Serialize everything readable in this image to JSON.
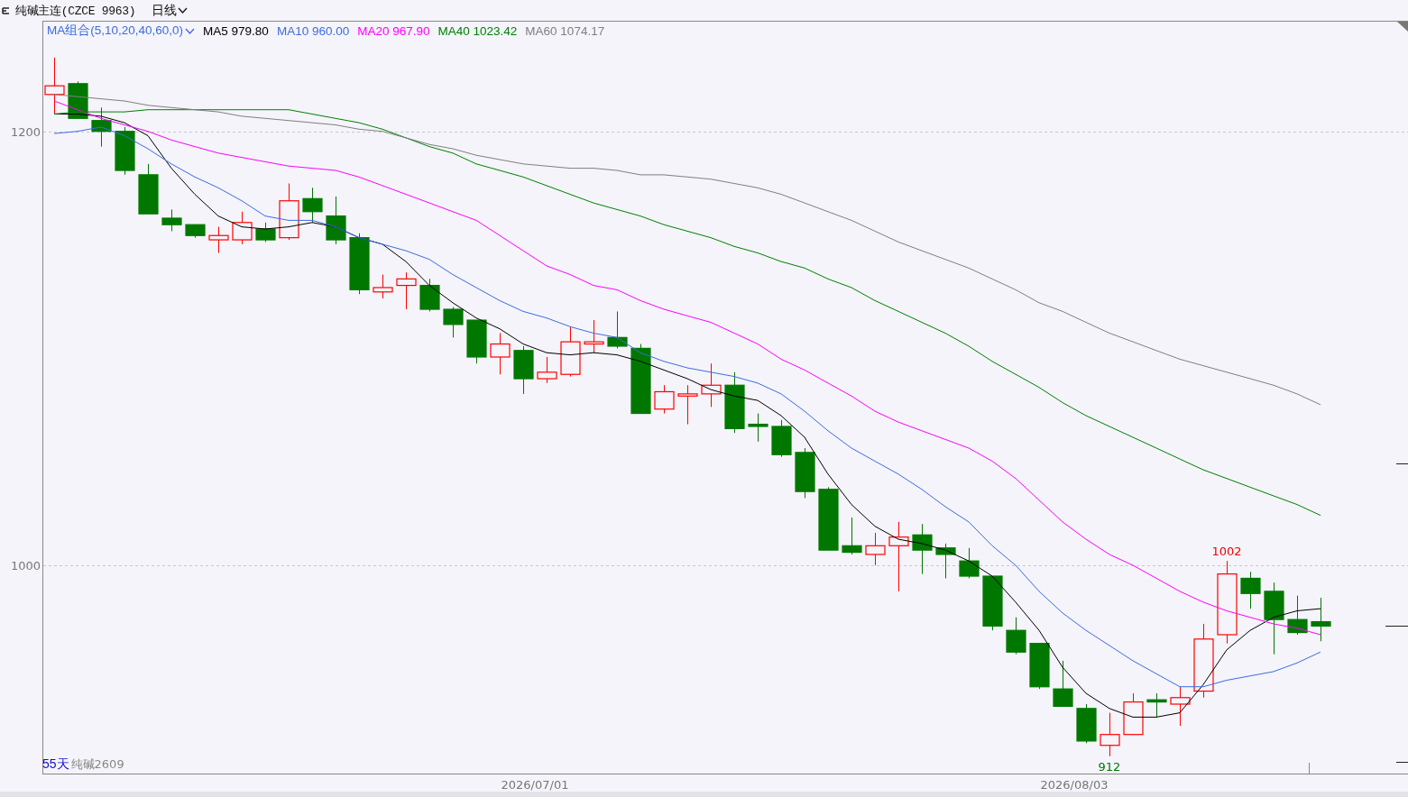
{
  "header": {
    "title": "纯碱主连(CZCE 9963)",
    "period": "日线"
  },
  "legend": {
    "group": "MA组合(5,10,20,40,60,0)",
    "values": [
      "979.80",
      "960.00",
      "967.90",
      "1023.42",
      "1074.17"
    ]
  },
  "chart": {
    "footer_count": "55天",
    "chart_data": {
      "type": "candlestick",
      "ylim": [
        904,
        1251
      ],
      "yticks": [
        1000,
        1200
      ],
      "series": [
        {
          "name": "纯碱2609",
          "ohlc": [
            [
              1217,
              1234,
              1208,
              1221
            ],
            [
              1222,
              1223,
              1206,
              1206
            ],
            [
              1205,
              1211,
              1193,
              1200
            ],
            [
              1200,
              1202,
              1180,
              1182
            ],
            [
              1180,
              1185,
              1162,
              1162
            ],
            [
              1160,
              1164,
              1154,
              1157
            ],
            [
              1157,
              1157,
              1151,
              1152
            ],
            [
              1150,
              1156,
              1144,
              1152
            ],
            [
              1150,
              1163,
              1148,
              1158
            ],
            [
              1155,
              1158,
              1149,
              1150
            ],
            [
              1151,
              1176,
              1150,
              1168
            ],
            [
              1169,
              1174,
              1158,
              1163
            ],
            [
              1161,
              1170,
              1148,
              1150
            ],
            [
              1151,
              1153,
              1125,
              1127
            ],
            [
              1126,
              1134,
              1123,
              1128
            ],
            [
              1129,
              1135,
              1118,
              1132
            ],
            [
              1129,
              1132,
              1117,
              1118
            ],
            [
              1118,
              1119,
              1105,
              1111
            ],
            [
              1113,
              1113,
              1093,
              1096
            ],
            [
              1096,
              1107,
              1088,
              1102
            ],
            [
              1099,
              1101,
              1079,
              1086
            ],
            [
              1086,
              1096,
              1084,
              1089
            ],
            [
              1088,
              1110,
              1087,
              1103
            ],
            [
              1102,
              1113,
              1098,
              1103
            ],
            [
              1105,
              1117,
              1100,
              1101
            ],
            [
              1100,
              1102,
              1070,
              1070
            ],
            [
              1072,
              1083,
              1070,
              1080
            ],
            [
              1078,
              1083,
              1065,
              1079
            ],
            [
              1079,
              1093,
              1073,
              1083
            ],
            [
              1083,
              1089,
              1061,
              1063
            ],
            [
              1065,
              1070,
              1057,
              1064
            ],
            [
              1064,
              1067,
              1050,
              1051
            ],
            [
              1052,
              1054,
              1031,
              1034
            ],
            [
              1035,
              1036,
              1007,
              1007
            ],
            [
              1009,
              1022,
              1005,
              1006
            ],
            [
              1005,
              1015,
              1000,
              1009
            ],
            [
              1009,
              1020,
              988,
              1013
            ],
            [
              1014,
              1019,
              996,
              1007
            ],
            [
              1008,
              1010,
              994,
              1005
            ],
            [
              1002,
              1008,
              994,
              995
            ],
            [
              995,
              995,
              970,
              972
            ],
            [
              970,
              976,
              959,
              960
            ],
            [
              964,
              964,
              943,
              944
            ],
            [
              943,
              956,
              935,
              935
            ],
            [
              934,
              936,
              918,
              919
            ],
            [
              917,
              932,
              912,
              922
            ],
            [
              922,
              941,
              922,
              937
            ],
            [
              938,
              941,
              930,
              937
            ],
            [
              936,
              944,
              926,
              939
            ],
            [
              942,
              973,
              939,
              966
            ],
            [
              968,
              1002,
              964,
              996
            ],
            [
              994,
              997,
              980,
              987
            ],
            [
              988,
              992,
              959,
              975
            ],
            [
              975,
              986,
              968,
              969
            ],
            [
              974,
              985,
              965,
              972
            ]
          ]
        },
        {
          "name": "MA5",
          "type": "line",
          "color": "#000000",
          "values": [
            1208,
            1208,
            1207,
            1204,
            1198,
            1183,
            1171,
            1161,
            1156,
            1155,
            1156,
            1158,
            1156,
            1151,
            1148,
            1140,
            1129,
            1121,
            1114,
            1109,
            1102,
            1098,
            1097,
            1098,
            1097,
            1094,
            1090,
            1086,
            1081,
            1078,
            1076,
            1069,
            1059,
            1042,
            1028,
            1018,
            1012,
            1010,
            1007,
            1002,
            995,
            983,
            970,
            953,
            941,
            934,
            930,
            930,
            932,
            945,
            961,
            970,
            976,
            979,
            980
          ]
        },
        {
          "name": "MA10",
          "type": "line",
          "color": "#3d6ce0",
          "values": [
            1199,
            1200,
            1202,
            1198,
            1192,
            1185,
            1179,
            1174,
            1168,
            1161,
            1159,
            1159,
            1156,
            1151,
            1148,
            1145,
            1141,
            1134,
            1128,
            1122,
            1117,
            1114,
            1110,
            1107,
            1105,
            1098,
            1094,
            1091,
            1089,
            1087,
            1084,
            1079,
            1071,
            1062,
            1054,
            1048,
            1042,
            1035,
            1027,
            1020,
            1009,
            1000,
            988,
            978,
            970,
            963,
            956,
            950,
            944,
            944,
            947,
            949,
            951,
            955,
            960
          ]
        },
        {
          "name": "MA20",
          "type": "line",
          "color": "#ff00ff",
          "values": [
            1214,
            1210,
            1206,
            1203,
            1200,
            1196,
            1193,
            1190,
            1188,
            1186,
            1184,
            1183,
            1182,
            1179,
            1175,
            1171,
            1167,
            1163,
            1159,
            1152,
            1145,
            1138,
            1134,
            1129,
            1127,
            1122,
            1118,
            1115,
            1112,
            1107,
            1102,
            1095,
            1090,
            1084,
            1078,
            1071,
            1066,
            1062,
            1058,
            1054,
            1048,
            1040,
            1030,
            1020,
            1012,
            1005,
            1000,
            994,
            988,
            983,
            979,
            976,
            973,
            971,
            968
          ]
        },
        {
          "name": "MA40",
          "type": "line",
          "color": "#008000",
          "values": [
            1208,
            1209,
            1209,
            1209,
            1210,
            1210,
            1210,
            1210,
            1210,
            1210,
            1210,
            1208,
            1206,
            1204,
            1201,
            1197,
            1193,
            1190,
            1185,
            1182,
            1179,
            1175,
            1171,
            1167,
            1164,
            1161,
            1157,
            1154,
            1151,
            1147,
            1144,
            1140,
            1137,
            1132,
            1128,
            1122,
            1117,
            1112,
            1107,
            1101,
            1094,
            1088,
            1082,
            1075,
            1069,
            1064,
            1059,
            1054,
            1049,
            1044,
            1040,
            1036,
            1032,
            1028,
            1023
          ]
        },
        {
          "name": "MA60",
          "type": "line",
          "color": "#808080",
          "values": [
            1217,
            1216,
            1215,
            1214,
            1212,
            1211,
            1210,
            1209,
            1207,
            1206,
            1205,
            1204,
            1203,
            1201,
            1200,
            1197,
            1194,
            1192,
            1189,
            1187,
            1185,
            1184,
            1183,
            1183,
            1182,
            1180,
            1180,
            1179,
            1178,
            1176,
            1174,
            1171,
            1167,
            1163,
            1159,
            1154,
            1149,
            1145,
            1141,
            1137,
            1132,
            1127,
            1121,
            1117,
            1112,
            1107,
            1103,
            1099,
            1095,
            1092,
            1089,
            1086,
            1083,
            1079,
            1074
          ]
        }
      ],
      "annotations": [
        "1002",
        "912"
      ]
    },
    "date_labels": [
      "2026/07/01",
      "2026/08/03"
    ]
  }
}
